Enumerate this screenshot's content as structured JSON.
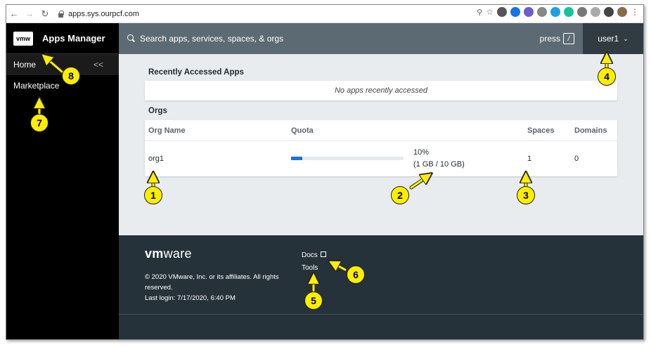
{
  "browser": {
    "url": "apps.sys.ourpcf.com"
  },
  "sidebar": {
    "logo_text": "vmw",
    "app_title": "Apps Manager",
    "collapse_glyph": "<<",
    "items": [
      {
        "label": "Home"
      },
      {
        "label": "Marketplace"
      }
    ]
  },
  "header": {
    "search_placeholder": "Search apps, services, spaces, & orgs",
    "press_label": "press",
    "shortcut_key": "/",
    "user_name": "user1"
  },
  "recent": {
    "title": "Recently Accessed Apps",
    "empty_message": "No apps recently accessed"
  },
  "orgs": {
    "title": "Orgs",
    "columns": [
      "Org Name",
      "Quota",
      "Spaces",
      "Domains"
    ],
    "rows": [
      {
        "name": "org1",
        "quota_fraction": 0.1,
        "quota_percent": "10%",
        "quota_detail": "(1 GB / 10 GB)",
        "spaces": "1",
        "domains": "0"
      }
    ]
  },
  "footer": {
    "logo_bold": "vm",
    "logo_light": "ware",
    "copyright": "© 2020 VMware, Inc. or its affiliates. All rights reserved.",
    "last_login": "Last login: 7/17/2020, 6:40 PM",
    "links": [
      {
        "label": "Docs"
      },
      {
        "label": "Tools"
      }
    ]
  },
  "annotations": [
    "1",
    "2",
    "3",
    "4",
    "5",
    "6",
    "7",
    "8"
  ],
  "colors": {
    "annotation": "#fdee00",
    "header": "#5c6b73",
    "user_menu": "#313c42",
    "footer": "#26323a",
    "quota_fill": "#1a73d9"
  }
}
